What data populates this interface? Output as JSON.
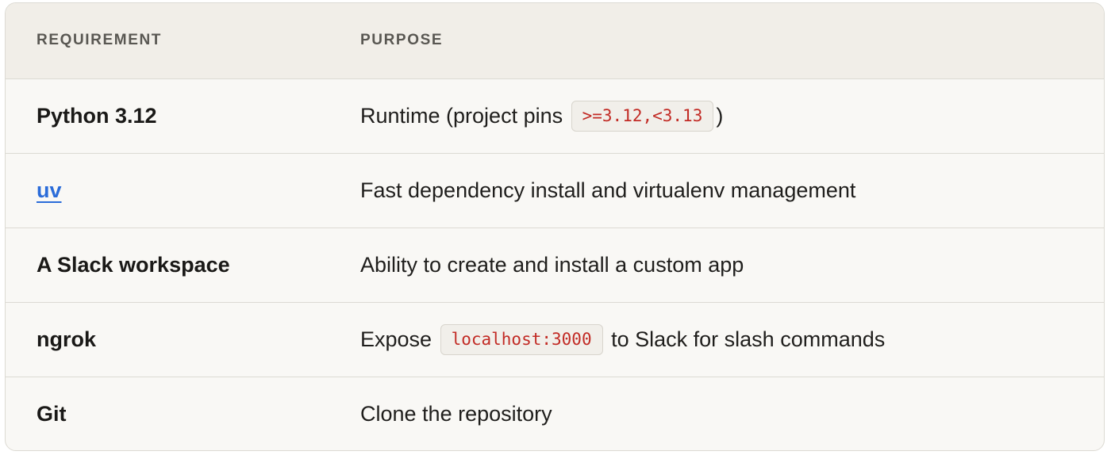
{
  "table": {
    "headers": {
      "requirement": "REQUIREMENT",
      "purpose": "PURPOSE"
    },
    "rows": [
      {
        "requirement": "Python 3.12",
        "purpose_before": "Runtime (project pins",
        "purpose_code": ">=3.12,<3.13",
        "purpose_after": ")"
      },
      {
        "requirement": "uv",
        "purpose": "Fast dependency install and virtualenv management"
      },
      {
        "requirement": "A Slack workspace",
        "purpose": "Ability to create and install a custom app"
      },
      {
        "requirement": "ngrok",
        "purpose_before": "Expose",
        "purpose_code": "localhost:3000",
        "purpose_after": "to Slack for slash commands"
      },
      {
        "requirement": "Git",
        "purpose": "Clone the repository"
      }
    ]
  },
  "colors": {
    "link": "#2b6cd9",
    "code_text": "#c22b25",
    "header_bg": "#f1eee8",
    "body_bg": "#f9f8f5",
    "border": "#dcdad3"
  }
}
